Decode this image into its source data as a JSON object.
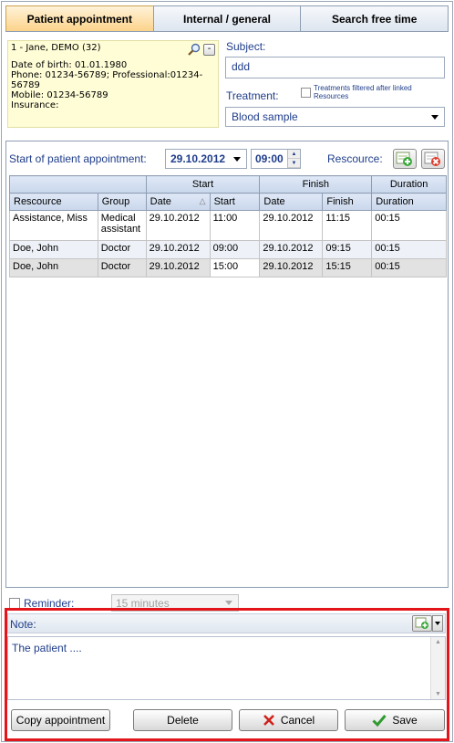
{
  "tabs": [
    {
      "label": "Patient appointment",
      "active": true
    },
    {
      "label": "Internal / general",
      "active": false
    },
    {
      "label": "Search free time",
      "active": false
    }
  ],
  "patient": {
    "name": "1 - Jane, DEMO (32)",
    "dob": "Date of birth: 01.01.1980",
    "phone": "Phone: 01234-56789; Professional:01234-56789",
    "mobile": "Mobile: 01234-56789",
    "insurance": "Insurance:",
    "minus_label": "-"
  },
  "subject": {
    "label": "Subject:",
    "value": "ddd"
  },
  "treatment": {
    "label": "Treatment:",
    "filter_label": "Treatments filtered after linked Resources",
    "filter_checked": false,
    "selected": "Blood sample"
  },
  "appointment": {
    "start_label": "Start of patient appointment:",
    "date": "29.10.2012",
    "time": "09:00",
    "rescource_label": "Rescource:"
  },
  "grid": {
    "group_headers": {
      "start": "Start",
      "finish": "Finish",
      "duration": "Duration"
    },
    "columns": [
      "Rescource",
      "Group",
      "Date",
      "Start",
      "Date",
      "Finish",
      "Duration"
    ],
    "rows": [
      [
        "Assistance, Miss",
        "Medical assistant",
        "29.10.2012",
        "11:00",
        "29.10.2012",
        "11:15",
        "00:15"
      ],
      [
        "Doe, John",
        "Doctor",
        "29.10.2012",
        "09:00",
        "29.10.2012",
        "09:15",
        "00:15"
      ],
      [
        "Doe, John",
        "Doctor",
        "29.10.2012",
        "15:00",
        "29.10.2012",
        "15:15",
        "00:15"
      ]
    ]
  },
  "reminder": {
    "label": "Reminder:",
    "checked": false,
    "value": "15 minutes"
  },
  "note": {
    "label": "Note:",
    "text": "The patient ...."
  },
  "buttons": {
    "copy": "Copy appointment",
    "delete": "Delete",
    "cancel": "Cancel",
    "save": "Save"
  },
  "colors": {
    "accent_red": "#e3151a",
    "label_blue": "#1f3d8a",
    "active_tab": "#fcd38a"
  }
}
